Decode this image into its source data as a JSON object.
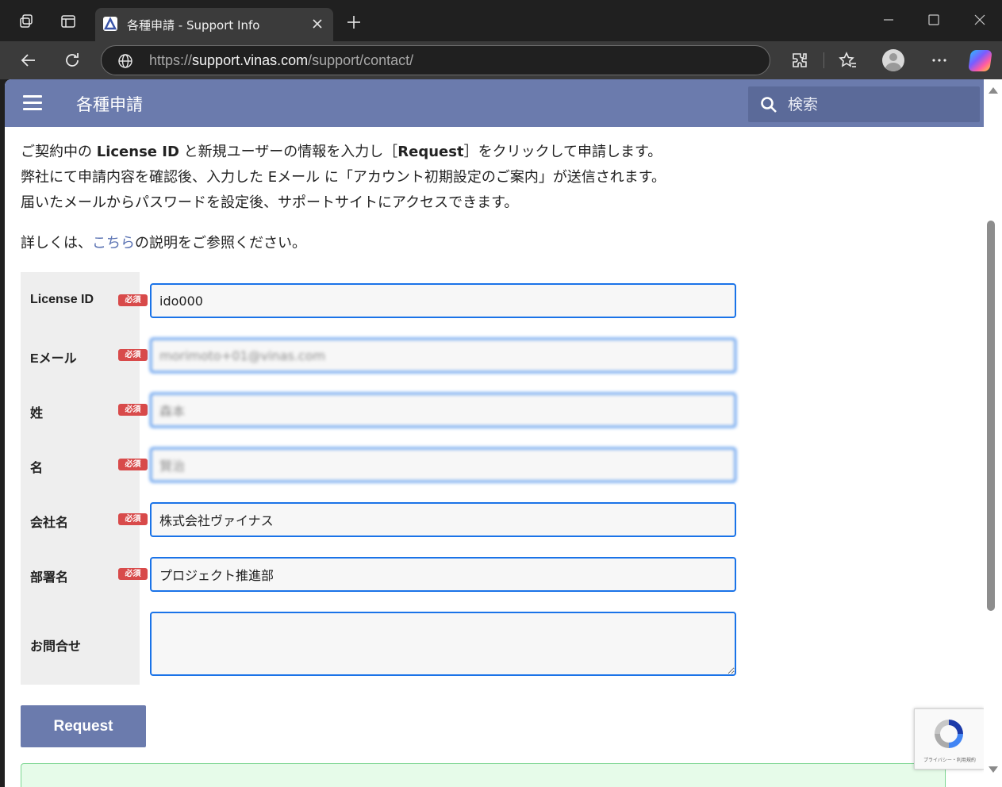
{
  "browser": {
    "tab_title": "各種申請 - Support Info",
    "url_scheme": "https://",
    "url_host": "support.vinas.com",
    "url_path": "/support/contact/"
  },
  "header": {
    "title": "各種申請",
    "search_placeholder": "検索",
    "color": "#6b7bad"
  },
  "intro": {
    "line1_a": "ご契約中の ",
    "line1_b": "License ID",
    "line1_c": " と新規ユーザーの情報を入力し［",
    "line1_d": "Request",
    "line1_e": "］をクリックして申請します。",
    "line2": "弊社にて申請内容を確認後、入力した Eメール に「アカウント初期設定のご案内」が送信されます。",
    "line3": "届いたメールからパスワードを設定後、サポートサイトにアクセスできます。"
  },
  "detail": {
    "prefix": "詳しくは、",
    "link": "こちら",
    "suffix": "の説明をご参照ください。"
  },
  "form": {
    "required_badge": "必須",
    "fields": [
      {
        "label": "License ID",
        "value": "ido000"
      },
      {
        "label": "Eメール",
        "value": "morimoto+01@vinas.com"
      },
      {
        "label": "姓",
        "value": "森本"
      },
      {
        "label": "名",
        "value": "賢治"
      },
      {
        "label": "会社名",
        "value": "株式会社ヴァイナス"
      },
      {
        "label": "部署名",
        "value": "プロジェクト推進部"
      }
    ],
    "inquiry_label": "お問合せ",
    "inquiry_value": "",
    "submit_label": "Request"
  },
  "recaptcha": {
    "text": "プライバシー・利用規約"
  }
}
